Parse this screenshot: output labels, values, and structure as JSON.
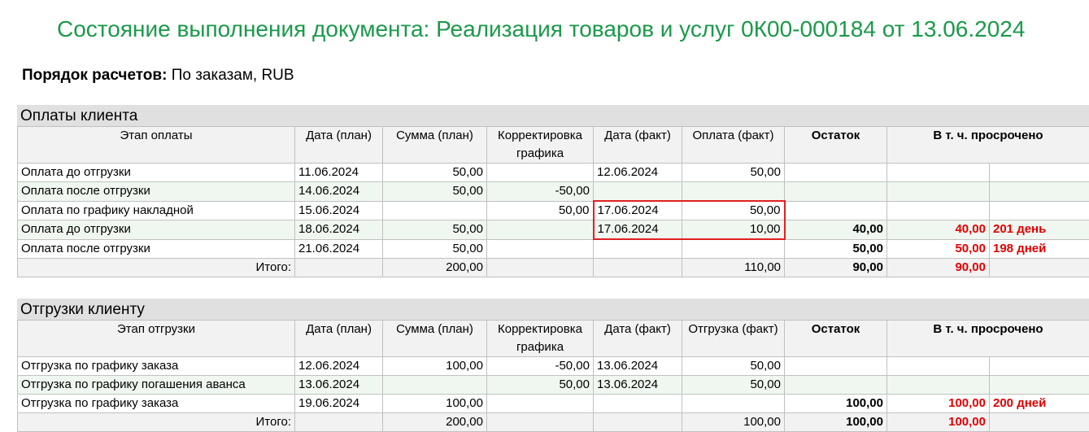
{
  "title": "Состояние выполнения документа: Реализация товаров и услуг 0К00-000184 от 13.06.2024",
  "calc_label": "Порядок расчетов:",
  "calc_value": "По заказам, RUB",
  "payments": {
    "section_title": "Оплаты клиента",
    "headers": [
      "Этап оплаты",
      "Дата (план)",
      "Сумма (план)",
      "Корректировка графика",
      "Дата (факт)",
      "Оплата (факт)",
      "Остаток",
      "В т. ч. просрочено"
    ],
    "rows": [
      [
        "Оплата до отгрузки",
        "11.06.2024",
        "50,00",
        "",
        "12.06.2024",
        "50,00",
        "",
        "",
        ""
      ],
      [
        "Оплата после отгрузки",
        "14.06.2024",
        "50,00",
        "-50,00",
        "",
        "",
        "",
        "",
        ""
      ],
      [
        "Оплата по графику накладной",
        "15.06.2024",
        "",
        "50,00",
        "17.06.2024",
        "50,00",
        "",
        "",
        ""
      ],
      [
        "Оплата до отгрузки",
        "18.06.2024",
        "50,00",
        "",
        "17.06.2024",
        "10,00",
        "40,00",
        "40,00",
        "201 день"
      ],
      [
        "Оплата после отгрузки",
        "21.06.2024",
        "50,00",
        "",
        "",
        "",
        "50,00",
        "50,00",
        "198 дней"
      ]
    ],
    "total": [
      "Итого:",
      "",
      "200,00",
      "",
      "",
      "110,00",
      "90,00",
      "90,00",
      ""
    ]
  },
  "shipments": {
    "section_title": "Отгрузки клиенту",
    "headers": [
      "Этап отгрузки",
      "Дата (план)",
      "Сумма (план)",
      "Корректировка графика",
      "Дата (факт)",
      "Отгрузка (факт)",
      "Остаток",
      "В т. ч. просрочено"
    ],
    "rows": [
      [
        "Отгрузка по графику заказа",
        "12.06.2024",
        "100,00",
        "-50,00",
        "13.06.2024",
        "50,00",
        "",
        "",
        ""
      ],
      [
        "Отгрузка по графику погашения аванса",
        "13.06.2024",
        "",
        "50,00",
        "13.06.2024",
        "50,00",
        "",
        "",
        ""
      ],
      [
        "Отгрузка по графику заказа",
        "19.06.2024",
        "100,00",
        "",
        "",
        "",
        "100,00",
        "100,00",
        "200 дней"
      ]
    ],
    "total": [
      "Итого:",
      "",
      "200,00",
      "",
      "",
      "100,00",
      "100,00",
      "100,00",
      ""
    ]
  },
  "colors": {
    "title": "#1a9a4a",
    "overdue": "#e00000",
    "highlight": "#e02020"
  }
}
